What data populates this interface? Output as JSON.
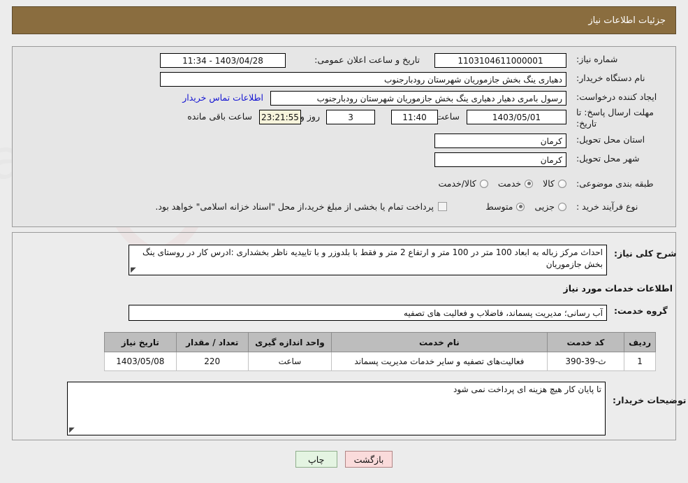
{
  "header": {
    "title": "جزئیات اطلاعات نیاز",
    "bg_color": "#8a6d3f",
    "text_color": "#ffffff"
  },
  "watermark": {
    "text": "AriaTender.net",
    "shield_color": "#f0d5d5"
  },
  "form": {
    "need_number": {
      "label": "شماره نیاز:",
      "value": "1103104611000001"
    },
    "public_announce": {
      "label": "تاریخ و ساعت اعلان عمومی:",
      "value": "1403/04/28 - 11:34"
    },
    "buyer_org": {
      "label": "نام دستگاه خریدار:",
      "value": "دهیاری ینگ بخش جازموریان شهرستان رودبارجنوب"
    },
    "requester": {
      "label": "ایجاد کننده درخواست:",
      "value": "رسول بامری دهیار دهیاری ینگ بخش جازموریان شهرستان رودبارجنوب"
    },
    "contact_link": {
      "label": "اطلاعات تماس خریدار"
    },
    "deadline": {
      "label": "مهلت ارسال پاسخ: تا تاریخ:",
      "date": "1403/05/01",
      "time_label": "ساعت",
      "time": "11:40",
      "days": "3",
      "days_label": "روز و",
      "countdown": "23:21:55",
      "countdown_label": "ساعت باقی مانده"
    },
    "delivery_province": {
      "label": "استان محل تحویل:",
      "value": "کرمان"
    },
    "delivery_city": {
      "label": "شهر محل تحویل:",
      "value": "کرمان"
    },
    "category": {
      "label": "طبقه بندی موضوعی:",
      "options": [
        {
          "label": "کالا",
          "selected": false
        },
        {
          "label": "خدمت",
          "selected": true
        },
        {
          "label": "کالا/خدمت",
          "selected": false
        }
      ]
    },
    "process_type": {
      "label": "نوع فرآیند خرید :",
      "options": [
        {
          "label": "جزیی",
          "selected": false
        },
        {
          "label": "متوسط",
          "selected": true
        }
      ],
      "checkbox_label": "پرداخت تمام یا بخشی از مبلغ خرید،از محل \"اسناد خزانه اسلامی\" خواهد بود.",
      "checkbox_checked": false
    },
    "general_description": {
      "label": "شرح کلی نیاز:",
      "value": "احداث مرکز زباله به ابعاد 100 متر در 100 متر و ارتفاع 2 متر و فقط با بلدوزر و با تاییدیه ناظر بخشداری :ادرس کار در روستای ینگ بخش جازموریان"
    },
    "services_section_title": "اطلاعات خدمات مورد نیاز",
    "service_group": {
      "label": "گروه خدمت:",
      "value": "آب رسانی؛ مدیریت پسماند، فاضلاب و فعالیت های تصفیه"
    },
    "buyer_notes": {
      "label": "توضیحات خریدار:",
      "value": "تا پایان کار هیچ هزینه ای پرداخت نمی شود"
    }
  },
  "table": {
    "columns": [
      "ردیف",
      "کد خدمت",
      "نام خدمت",
      "واحد اندازه گیری",
      "تعداد / مقدار",
      "تاریخ نیاز"
    ],
    "rows": [
      {
        "radif": "1",
        "code": "ث-39-390",
        "name": "فعالیت‌های تصفیه و سایر خدمات مدیریت پسماند",
        "unit": "ساعت",
        "qty": "220",
        "date": "1403/05/08"
      }
    ]
  },
  "footer": {
    "back_button": "بازگشت",
    "print_button": "چاپ"
  }
}
